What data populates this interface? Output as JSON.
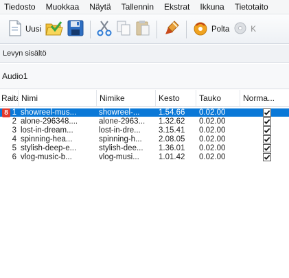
{
  "menu": [
    "Tiedosto",
    "Muokkaa",
    "Näytä",
    "Tallennin",
    "Ekstrat",
    "Ikkuna",
    "Tietotaito"
  ],
  "toolbar": {
    "new_label": "Uusi",
    "burn_label": "Polta",
    "last_label": "K",
    "icons": [
      "new-document-icon",
      "open-folder-icon",
      "save-disk-icon",
      "cut-icon",
      "copy-icon",
      "paste-icon",
      "edit-tool-icon",
      "burn-disc-icon",
      "disc-icon"
    ]
  },
  "section_label": "Levyn sisältö",
  "list_title": "Audio1",
  "columns": [
    "Raita",
    "Nimi",
    "Nimike",
    "Kesto",
    "Tauko",
    "Norma..."
  ],
  "tracks": [
    {
      "badge": "8",
      "track": "1",
      "name": "showreel-mus...",
      "title": "showreel-...",
      "duration": "1.54.66",
      "pause": "0.02.00",
      "normalized": true
    },
    {
      "track": "2",
      "name": "alone-296348....",
      "title": "alone-2963...",
      "duration": "1.32.62",
      "pause": "0.02.00",
      "normalized": true
    },
    {
      "track": "3",
      "name": "lost-in-dream...",
      "title": "lost-in-dre...",
      "duration": "3.15.41",
      "pause": "0.02.00",
      "normalized": true
    },
    {
      "track": "4",
      "name": "spinning-hea...",
      "title": "spinning-h...",
      "duration": "2.08.05",
      "pause": "0.02.00",
      "normalized": true
    },
    {
      "track": "5",
      "name": "stylish-deep-e...",
      "title": "stylish-dee...",
      "duration": "1.36.01",
      "pause": "0.02.00",
      "normalized": true
    },
    {
      "track": "6",
      "name": "vlog-music-b...",
      "title": "vlog-musi...",
      "duration": "1.01.42",
      "pause": "0.02.00",
      "normalized": true
    }
  ],
  "colors": {
    "selection": "#0a78d7",
    "badge": "#e23a2d"
  }
}
